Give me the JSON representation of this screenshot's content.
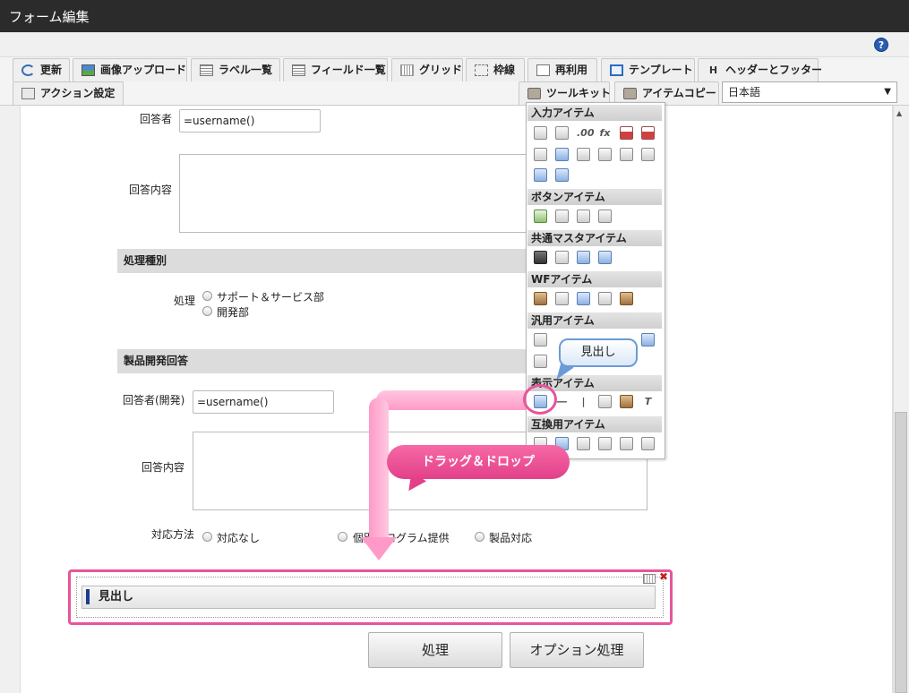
{
  "window": {
    "title": "フォーム編集"
  },
  "toolbar": {
    "tabs": [
      {
        "label": "更新",
        "icon": "refresh-icon"
      },
      {
        "label": "画像アップロード",
        "icon": "image-upload-icon"
      },
      {
        "label": "ラベル一覧",
        "icon": "label-list-icon"
      },
      {
        "label": "フィールド一覧",
        "icon": "field-list-icon"
      },
      {
        "label": "グリッド",
        "icon": "grid-icon"
      },
      {
        "label": "枠線",
        "icon": "border-icon"
      },
      {
        "label": "再利用",
        "icon": "reuse-icon"
      },
      {
        "label": "テンプレート",
        "icon": "template-icon"
      },
      {
        "label": "ヘッダーとフッター",
        "icon": "header-footer-icon"
      },
      {
        "label": "アクション設定",
        "icon": "action-icon"
      },
      {
        "label": "ツールキット",
        "icon": "toolkit-icon"
      },
      {
        "label": "アイテムコピー",
        "icon": "item-copy-icon"
      }
    ],
    "header_icon_letter": "H",
    "language": "日本語",
    "help": "?"
  },
  "form": {
    "respondent_label": "回答者",
    "respondent_value": "=username()",
    "answer_label": "回答内容",
    "section1": "処理種別",
    "process_label": "処理",
    "process_options": [
      "サポート＆サービス部",
      "開発部"
    ],
    "section2": "製品開発回答",
    "dev_respondent_label": "回答者(開発)",
    "dev_respondent_value": "=username()",
    "dev_answer_label": "回答内容",
    "method_label": "対応方法",
    "method_options": [
      "対応なし",
      "個別プログラム提供",
      "製品対応"
    ],
    "heading_item": "見出し",
    "buttons": [
      "処理",
      "オプション処理"
    ]
  },
  "palette": {
    "categories": [
      "入力アイテム",
      "ボタンアイテム",
      "共通マスタアイテム",
      "WFアイテム",
      "汎用アイテム",
      "表示アイテム",
      "互換用アイテム"
    ],
    "fx_symbol": "fx",
    "decimal_symbol": ".00",
    "text_symbol": "T"
  },
  "callout": {
    "text": "見出し"
  },
  "drag_label": "ドラッグ＆ドロップ",
  "colors": {
    "highlight": "#e8559a",
    "drag": "#ff9ac8",
    "callout_border": "#6a9bd8",
    "heading_bar": "#1d3d8f"
  }
}
